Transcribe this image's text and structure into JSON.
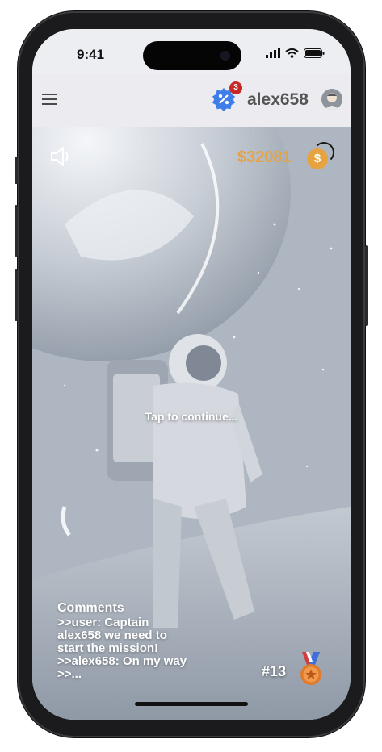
{
  "status_bar": {
    "time": "9:41"
  },
  "header": {
    "notification_count": "3",
    "username": "alex658"
  },
  "hud": {
    "money": "$32081",
    "coin_symbol": "$"
  },
  "scene": {
    "tap_prompt": "Tap to continue..."
  },
  "comments": {
    "title": "Comments",
    "lines": [
      ">>user: Captain",
      "alex658 we need to",
      "start the mission!",
      ">>alex658: On my way",
      ">>..."
    ]
  },
  "rank": {
    "label": "#13"
  },
  "colors": {
    "accent_gold": "#e8a341",
    "badge_blue": "#3f7ee8",
    "notif_red": "#c62828",
    "medal_orange": "#e07b2b"
  },
  "icons": {
    "menu": "menu-icon",
    "badge": "discount-badge-icon",
    "avatar": "user-avatar",
    "sound": "speaker-icon",
    "coin": "coin-icon",
    "medal": "medal-icon"
  }
}
